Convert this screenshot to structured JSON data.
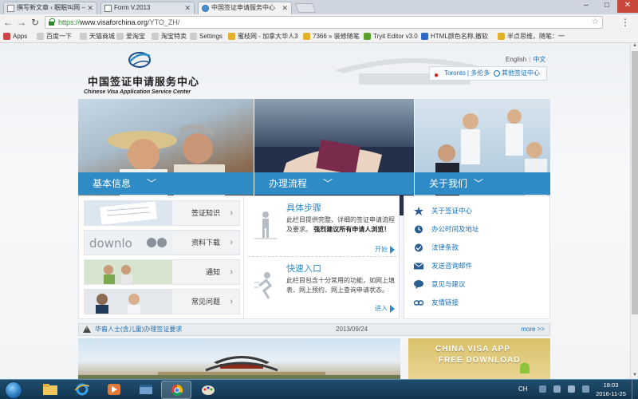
{
  "browser": {
    "tabs": [
      {
        "title": "撰写新文章 ‹ 眠眠叫网 –",
        "active": false
      },
      {
        "title": "Form V.2013",
        "active": false
      },
      {
        "title": "中国签证申请服务中心",
        "active": true
      }
    ],
    "url": {
      "protocol": "https://",
      "host": "www.visaforchina.org",
      "path": "/YTO_ZH/"
    },
    "bookmarks": [
      "Apps",
      "百度一下",
      "天猫商城",
      "爱淘宝",
      "淘宝特卖",
      "Settings",
      "蜜枝网 - 加拿大华人3",
      "7366 » 装修随笔",
      "Tryit Editor v3.0",
      "HTML颜色名称,撤软",
      "半点思维，随笔：一"
    ]
  },
  "site": {
    "logo_cn": "中国签证申请服务中心",
    "logo_en": "Chinese Visa Application Service Center",
    "lang_en": "English",
    "lang_zh": "中文",
    "city": "Toronto | 多伦多",
    "other_centers": "其他签证中心"
  },
  "sections": [
    {
      "label": "基本信息"
    },
    {
      "label": "办理流程"
    },
    {
      "label": "关于我们"
    }
  ],
  "basic_info": [
    "签证知识",
    "资料下载",
    "通知",
    "常见问题"
  ],
  "process": [
    {
      "title": "具体步骤",
      "desc": "此栏目提供完整、详细的签证申请流程及要求。",
      "bold": "强烈建议所有申请人浏览！",
      "go": "开始"
    },
    {
      "title": "快速入口",
      "desc": "此栏目包含十分常用的功能，如网上填表、网上预约、网上查询申请状态。",
      "bold": "",
      "go": "进入"
    }
  ],
  "about": [
    {
      "label": "关于签证中心",
      "icon": "star-icon"
    },
    {
      "label": "办公时间及地址",
      "icon": "clock-icon"
    },
    {
      "label": "法律条款",
      "icon": "check-icon"
    },
    {
      "label": "发送咨询邮件",
      "icon": "mail-icon"
    },
    {
      "label": "意见与建议",
      "icon": "chat-icon"
    },
    {
      "label": "友情链接",
      "icon": "link-icon"
    }
  ],
  "notice": {
    "text": "华裔人士(含儿童)办理签证要求",
    "date": "2013/09/24",
    "more": "more >>"
  },
  "app_banner": {
    "line1": "CHINA VISA APP",
    "line2": "FREE DOWNLOAD"
  },
  "taskbar": {
    "lang": "CH",
    "time": "18:03",
    "date": "2016-11-25"
  },
  "colors": {
    "accent": "#2f8bc6",
    "link": "#1a6fb5"
  }
}
